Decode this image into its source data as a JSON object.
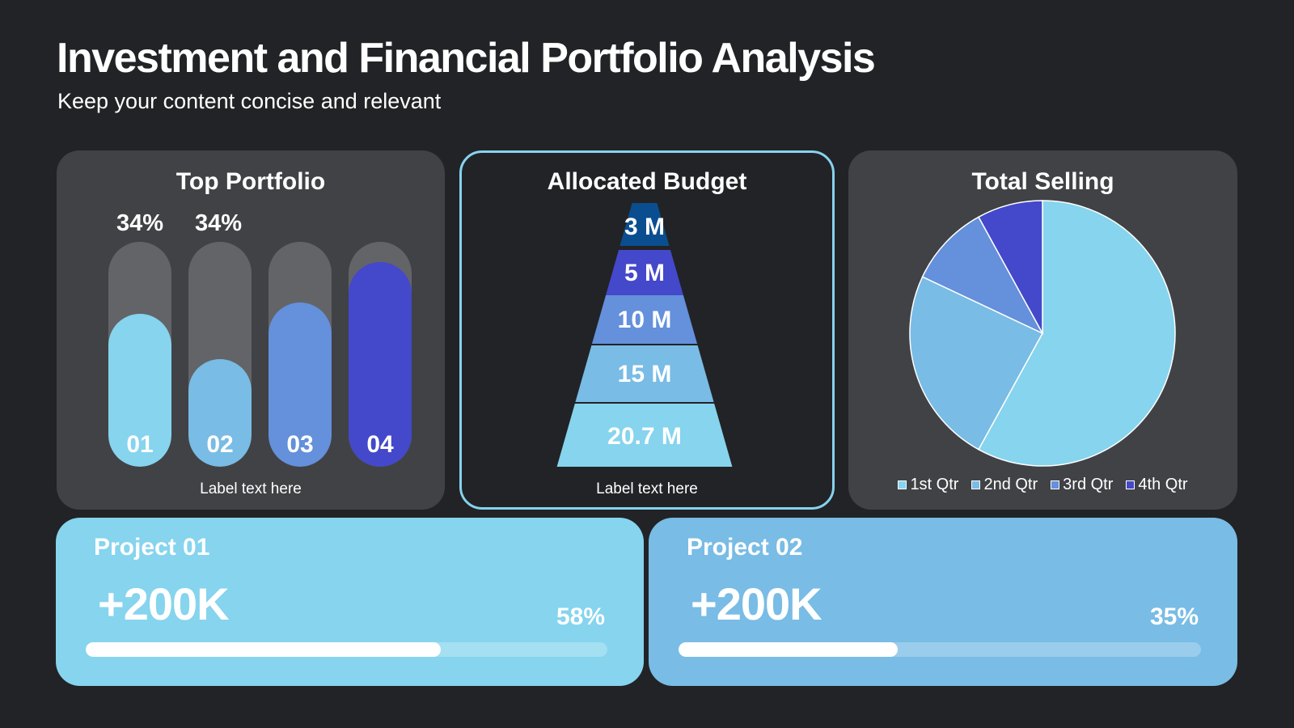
{
  "header": {
    "title": "Investment and Financial Portfolio Analysis",
    "subtitle": "Keep your content concise and relevant"
  },
  "colors": {
    "background": "#222326",
    "card": "#414245",
    "track": "#636468",
    "q1": "#86d4ee",
    "q2": "#79bce5",
    "q3": "#6490dc",
    "q4": "#4448ca",
    "pyramid_top": "#0a4e90"
  },
  "chart_data": [
    {
      "type": "bar",
      "title": "Top Portfolio",
      "xlabel": "Label text here",
      "categories": [
        "01",
        "02",
        "03",
        "04"
      ],
      "values": [
        68,
        48,
        73,
        91
      ],
      "ylim": [
        0,
        100
      ],
      "value_labels": [
        "34%",
        "34%"
      ],
      "colors": [
        "#86d4ee",
        "#79bce5",
        "#6490dc",
        "#4448ca"
      ]
    },
    {
      "type": "bar",
      "subtype": "pyramid",
      "title": "Allocated Budget",
      "xlabel": "Label text here",
      "categories": [
        "3 M",
        "5 M",
        "10 M",
        "15 M",
        "20.7 M"
      ],
      "values": [
        3,
        5,
        10,
        15,
        20.7
      ],
      "colors": [
        "#0a4e90",
        "#4448ca",
        "#6490dc",
        "#79bce5",
        "#86d4ee"
      ]
    },
    {
      "type": "pie",
      "title": "Total Selling",
      "labels": [
        "1st Qtr",
        "2nd Qtr",
        "3rd Qtr",
        "4th Qtr"
      ],
      "values": [
        58,
        24,
        10,
        8
      ],
      "colors": [
        "#86d4ee",
        "#79bce5",
        "#6490dc",
        "#4448ca"
      ],
      "legend": "bottom"
    }
  ],
  "projects": [
    {
      "title": "Project 01",
      "value": "+200K",
      "percent_label": "58%",
      "progress": 0.68
    },
    {
      "title": "Project 02",
      "value": "+200K",
      "percent_label": "35%",
      "progress": 0.42
    }
  ]
}
